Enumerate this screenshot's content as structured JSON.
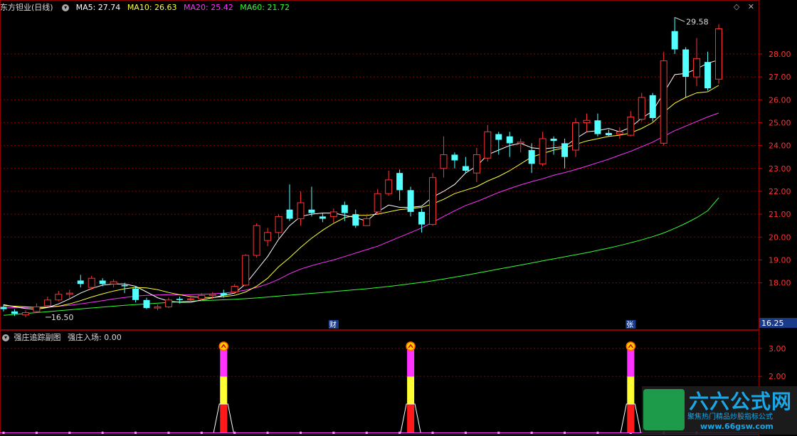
{
  "header": {
    "stock": "东方钽业(日线)",
    "ma": [
      {
        "label": "MA5: 27.74",
        "color": "#ffffff"
      },
      {
        "label": "MA10: 26.63",
        "color": "#ffff33"
      },
      {
        "label": "MA20: 25.42",
        "color": "#ff33ff"
      },
      {
        "label": "MA60: 21.72",
        "color": "#33ff33"
      }
    ]
  },
  "indicator": {
    "name": "强庄追踪副图",
    "value_label": "强庄入场: 0.00"
  },
  "markers": {
    "cai": "财",
    "zhang": "张",
    "current": "16.25",
    "high_label": "29.58",
    "low_label": "16.50"
  },
  "watermark": {
    "title": "六六公式网",
    "sub": "聚焦热门精品炒股指标公式",
    "url": "www.66gsw.com"
  },
  "colors": {
    "up": "#ff3333",
    "down": "#54ffff",
    "grid": "#8b0000"
  },
  "chart_data": [
    {
      "type": "candlestick",
      "ylim": [
        16.0,
        29.8
      ],
      "y_ticks": [
        "18.00",
        "19.00",
        "20.00",
        "21.00",
        "22.00",
        "23.00",
        "24.00",
        "25.00",
        "26.00",
        "27.00",
        "28.00"
      ],
      "candles": [
        [
          16.95,
          16.85,
          17.05,
          16.75
        ],
        [
          16.75,
          16.65,
          16.85,
          16.55
        ],
        [
          16.6,
          16.7,
          16.8,
          16.5
        ],
        [
          16.75,
          16.95,
          17.1,
          16.7
        ],
        [
          17.0,
          17.25,
          17.4,
          16.95
        ],
        [
          17.25,
          17.5,
          17.65,
          17.2
        ],
        [
          17.5,
          17.55,
          17.7,
          17.3
        ],
        [
          18.1,
          17.95,
          18.35,
          17.8
        ],
        [
          17.8,
          18.2,
          18.3,
          17.7
        ],
        [
          18.1,
          17.95,
          18.2,
          17.85
        ],
        [
          17.95,
          18.05,
          18.15,
          17.8
        ],
        [
          17.9,
          17.85,
          18.0,
          17.55
        ],
        [
          17.75,
          17.25,
          17.85,
          17.15
        ],
        [
          17.25,
          16.9,
          17.35,
          16.85
        ],
        [
          16.9,
          16.95,
          17.05,
          16.8
        ],
        [
          16.95,
          17.25,
          17.35,
          16.9
        ],
        [
          17.3,
          17.25,
          17.4,
          17.1
        ],
        [
          17.3,
          17.3,
          17.45,
          17.2
        ],
        [
          17.3,
          17.45,
          17.55,
          17.2
        ],
        [
          17.45,
          17.5,
          17.6,
          17.3
        ],
        [
          17.55,
          17.45,
          17.7,
          17.35
        ],
        [
          17.6,
          17.85,
          17.95,
          17.5
        ],
        [
          17.9,
          19.2,
          19.25,
          17.85
        ],
        [
          19.2,
          20.5,
          20.6,
          19.1
        ],
        [
          19.85,
          20.2,
          20.4,
          19.6
        ],
        [
          20.2,
          20.9,
          21.0,
          19.95
        ],
        [
          21.2,
          20.8,
          22.3,
          20.7
        ],
        [
          20.8,
          21.5,
          22.0,
          20.5
        ],
        [
          21.2,
          21.05,
          22.2,
          20.9
        ],
        [
          20.9,
          20.8,
          21.05,
          20.65
        ],
        [
          20.9,
          21.1,
          21.25,
          20.6
        ],
        [
          21.4,
          21.05,
          21.55,
          20.7
        ],
        [
          21.0,
          20.5,
          21.2,
          20.4
        ],
        [
          20.5,
          20.8,
          21.0,
          20.5
        ],
        [
          21.1,
          21.9,
          22.1,
          21.0
        ],
        [
          21.9,
          22.5,
          22.9,
          21.8
        ],
        [
          22.8,
          22.05,
          22.95,
          21.6
        ],
        [
          22.05,
          21.1,
          22.2,
          20.9
        ],
        [
          21.1,
          20.55,
          21.25,
          20.2
        ],
        [
          20.55,
          22.6,
          22.8,
          20.5
        ],
        [
          23.0,
          23.6,
          24.4,
          22.6
        ],
        [
          23.6,
          23.35,
          23.7,
          23.0
        ],
        [
          23.1,
          22.9,
          23.5,
          22.8
        ],
        [
          22.8,
          23.6,
          23.9,
          22.4
        ],
        [
          23.45,
          24.6,
          24.9,
          23.3
        ],
        [
          24.5,
          24.25,
          24.6,
          23.6
        ],
        [
          24.4,
          24.1,
          24.6,
          23.5
        ],
        [
          24.1,
          24.15,
          24.3,
          23.7
        ],
        [
          23.8,
          23.2,
          24.1,
          22.8
        ],
        [
          23.2,
          24.3,
          24.6,
          23.1
        ],
        [
          24.3,
          24.2,
          24.4,
          23.6
        ],
        [
          24.1,
          23.5,
          24.3,
          23.0
        ],
        [
          23.8,
          25.0,
          25.2,
          23.5
        ],
        [
          25.0,
          25.1,
          25.4,
          24.6
        ],
        [
          25.1,
          24.5,
          25.4,
          24.4
        ],
        [
          24.55,
          24.45,
          24.7,
          24.4
        ],
        [
          24.5,
          24.6,
          24.8,
          24.3
        ],
        [
          24.45,
          25.25,
          25.5,
          24.4
        ],
        [
          25.15,
          26.1,
          26.3,
          25.05
        ],
        [
          26.2,
          25.2,
          26.3,
          25.05
        ],
        [
          24.1,
          27.7,
          28.1,
          24.0
        ],
        [
          29.0,
          28.2,
          29.6,
          28.0
        ],
        [
          28.2,
          27.0,
          28.3,
          26.1
        ],
        [
          27.0,
          27.8,
          28.7,
          26.6
        ],
        [
          27.65,
          26.5,
          28.1,
          26.4
        ],
        [
          26.9,
          29.1,
          29.3,
          26.7
        ]
      ],
      "ma5": [
        17.05,
        16.95,
        16.88,
        16.85,
        16.92,
        17.08,
        17.3,
        17.55,
        17.75,
        17.9,
        17.95,
        17.95,
        17.85,
        17.6,
        17.35,
        17.2,
        17.15,
        17.15,
        17.25,
        17.35,
        17.45,
        17.55,
        17.95,
        18.55,
        19.15,
        19.9,
        20.5,
        20.9,
        21.0,
        21.05,
        21.05,
        20.95,
        20.85,
        20.7,
        21.1,
        21.4,
        21.3,
        21.3,
        21.35,
        21.75,
        22.0,
        22.3,
        22.8,
        23.1,
        23.6,
        23.8,
        24.0,
        24.1,
        23.9,
        23.85,
        23.9,
        23.95,
        24.3,
        24.6,
        24.65,
        24.75,
        24.6,
        24.8,
        25.2,
        25.5,
        26.3,
        27.1,
        27.15,
        27.35,
        27.6,
        27.74
      ],
      "ma10": [
        17.0,
        16.98,
        16.95,
        16.92,
        16.93,
        16.98,
        17.08,
        17.22,
        17.38,
        17.52,
        17.64,
        17.74,
        17.8,
        17.78,
        17.7,
        17.58,
        17.48,
        17.4,
        17.36,
        17.36,
        17.4,
        17.45,
        17.6,
        17.85,
        18.2,
        18.7,
        19.1,
        19.55,
        19.95,
        20.3,
        20.6,
        20.85,
        20.95,
        20.95,
        21.0,
        21.1,
        21.2,
        21.25,
        21.3,
        21.45,
        21.65,
        21.9,
        22.05,
        22.2,
        22.45,
        22.65,
        22.9,
        23.2,
        23.5,
        23.65,
        23.8,
        23.9,
        24.05,
        24.2,
        24.3,
        24.4,
        24.45,
        24.55,
        24.75,
        25.0,
        25.45,
        25.85,
        26.1,
        26.3,
        26.35,
        26.63
      ],
      "ma20": [
        16.9,
        16.92,
        16.93,
        16.94,
        16.95,
        16.98,
        17.02,
        17.08,
        17.15,
        17.22,
        17.3,
        17.36,
        17.42,
        17.45,
        17.47,
        17.48,
        17.48,
        17.48,
        17.5,
        17.52,
        17.55,
        17.6,
        17.68,
        17.8,
        17.95,
        18.15,
        18.4,
        18.6,
        18.75,
        18.88,
        19.0,
        19.15,
        19.3,
        19.45,
        19.6,
        19.8,
        20.0,
        20.2,
        20.4,
        20.65,
        20.9,
        21.15,
        21.38,
        21.55,
        21.75,
        21.95,
        22.12,
        22.28,
        22.42,
        22.55,
        22.7,
        22.82,
        22.95,
        23.1,
        23.25,
        23.4,
        23.58,
        23.75,
        23.95,
        24.15,
        24.4,
        24.65,
        24.85,
        25.05,
        25.25,
        25.42
      ],
      "ma60": [
        16.58,
        16.62,
        16.66,
        16.7,
        16.74,
        16.78,
        16.82,
        16.86,
        16.9,
        16.94,
        16.98,
        17.02,
        17.05,
        17.08,
        17.11,
        17.14,
        17.17,
        17.2,
        17.22,
        17.24,
        17.26,
        17.28,
        17.31,
        17.34,
        17.38,
        17.42,
        17.46,
        17.5,
        17.54,
        17.58,
        17.62,
        17.66,
        17.7,
        17.74,
        17.79,
        17.84,
        17.9,
        17.96,
        18.02,
        18.09,
        18.17,
        18.25,
        18.33,
        18.42,
        18.51,
        18.6,
        18.69,
        18.78,
        18.87,
        18.96,
        19.05,
        19.14,
        19.23,
        19.32,
        19.42,
        19.52,
        19.63,
        19.75,
        19.88,
        20.02,
        20.18,
        20.38,
        20.6,
        20.85,
        21.15,
        21.72
      ]
    },
    {
      "type": "bar",
      "title": "强庄追踪副图",
      "ylim": [
        0,
        3.3
      ],
      "y_ticks": [
        "2.00",
        "3.00"
      ],
      "signal_indices": [
        20,
        37,
        57
      ],
      "values": [
        3,
        3,
        3
      ]
    }
  ]
}
